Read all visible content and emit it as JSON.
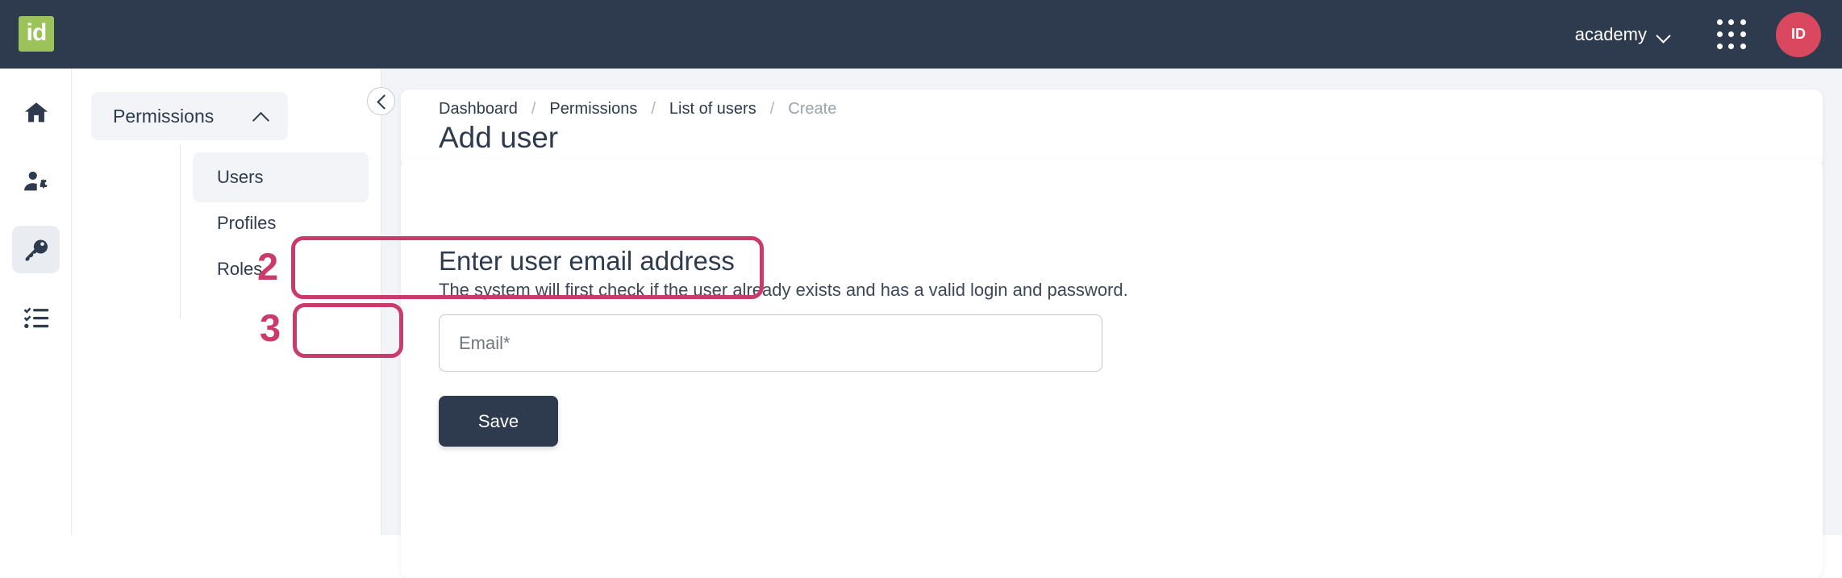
{
  "topbar": {
    "logo_text": "id",
    "logo_color": "#9cc35a",
    "tenant_label": "academy",
    "tenant_chevron_icon": "chevron-down-icon",
    "apps_icon": "apps-grid-icon",
    "avatar_initials": "ID",
    "avatar_color": "#d9485f",
    "background_color": "#2e3b4e"
  },
  "rail": {
    "items": [
      {
        "icon": "home-icon",
        "active": false
      },
      {
        "icon": "user-settings-icon",
        "active": false
      },
      {
        "icon": "key-icon",
        "active": true
      },
      {
        "icon": "checklist-icon",
        "active": false
      }
    ]
  },
  "subnav": {
    "header_label": "Permissions",
    "header_chevron_icon": "chevron-up-icon",
    "items": [
      {
        "label": "Users",
        "active": true
      },
      {
        "label": "Profiles",
        "active": false
      },
      {
        "label": "Roles",
        "active": false
      }
    ]
  },
  "collapse_button": {
    "icon": "chevron-left-icon"
  },
  "breadcrumb": {
    "separator": "/",
    "items": [
      {
        "label": "Dashboard",
        "current": false
      },
      {
        "label": "Permissions",
        "current": false
      },
      {
        "label": "List of users",
        "current": false
      },
      {
        "label": "Create",
        "current": true
      }
    ]
  },
  "page": {
    "title": "Add user"
  },
  "form": {
    "heading": "Enter user email address",
    "description": "The system will first check if the user already exists and has a valid login and password.",
    "email_placeholder": "Email*",
    "email_value": "",
    "save_label": "Save"
  },
  "annotations": {
    "color": "#ca3a6b",
    "steps": [
      {
        "number": "2",
        "target": "email-field"
      },
      {
        "number": "3",
        "target": "save-button"
      }
    ]
  }
}
